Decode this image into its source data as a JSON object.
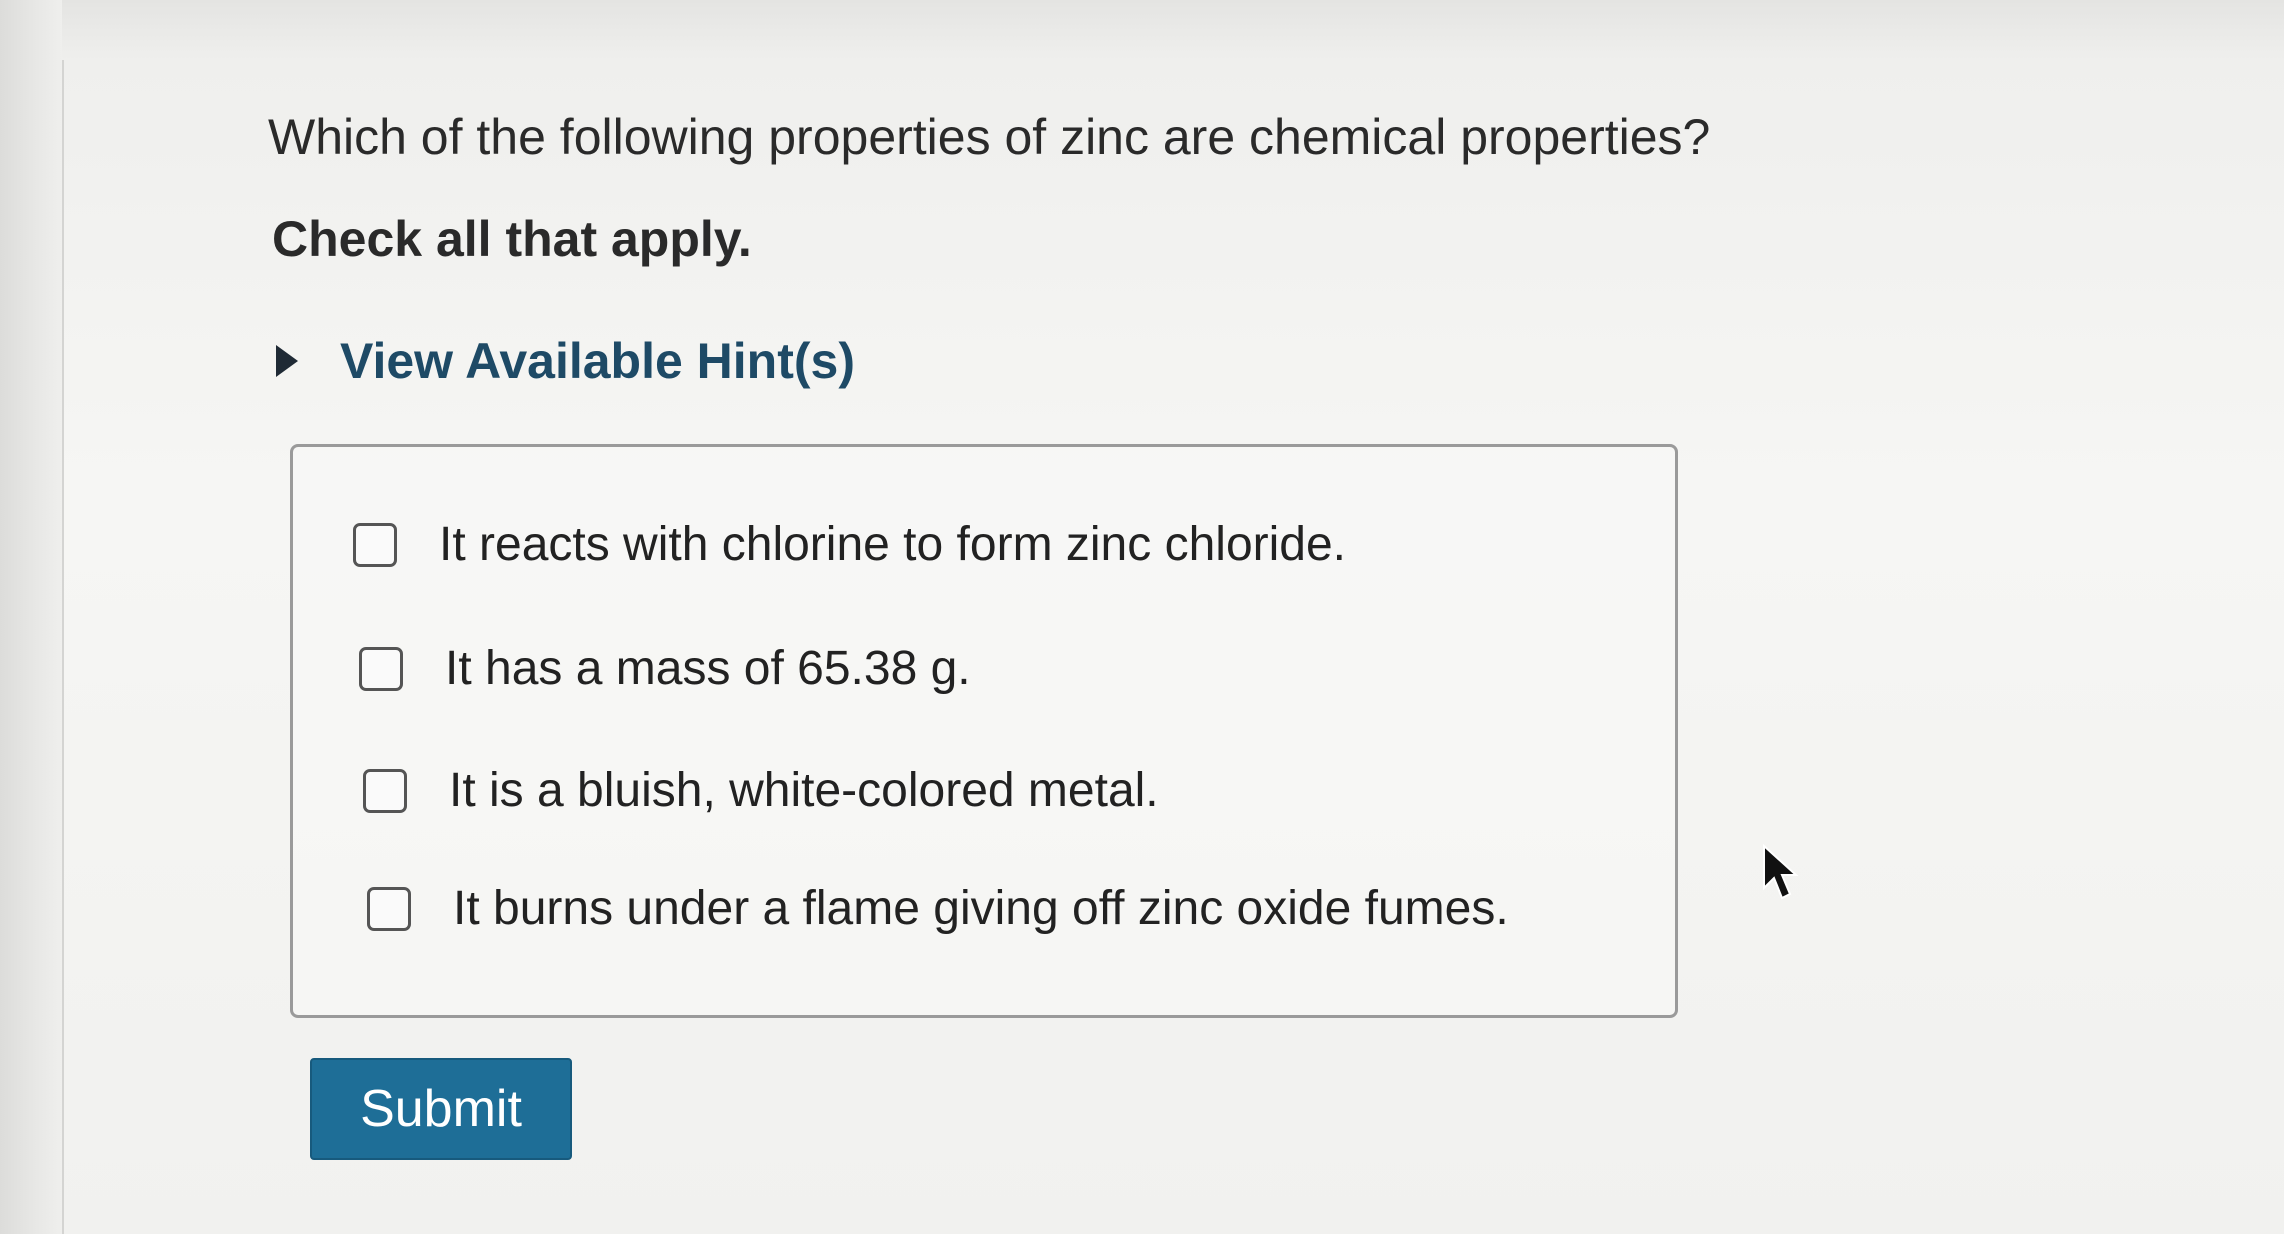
{
  "question": {
    "text": "Which of the following properties of zinc are chemical properties?",
    "instruction": "Check all that apply."
  },
  "hint": {
    "label": "View Available Hint(s)",
    "icon": "triangle-right-icon"
  },
  "options": [
    {
      "label": "It reacts with chlorine to form zinc chloride.",
      "checked": false
    },
    {
      "label": "It has a mass of 65.38 g.",
      "checked": false
    },
    {
      "label": "It is a bluish, white-colored metal.",
      "checked": false
    },
    {
      "label": "It burns under a flame giving off zinc oxide fumes.",
      "checked": false
    }
  ],
  "submit": {
    "label": "Submit"
  },
  "colors": {
    "accent": "#1e6e97",
    "hint_text": "#1e4a66",
    "border": "#9a9a9a"
  }
}
